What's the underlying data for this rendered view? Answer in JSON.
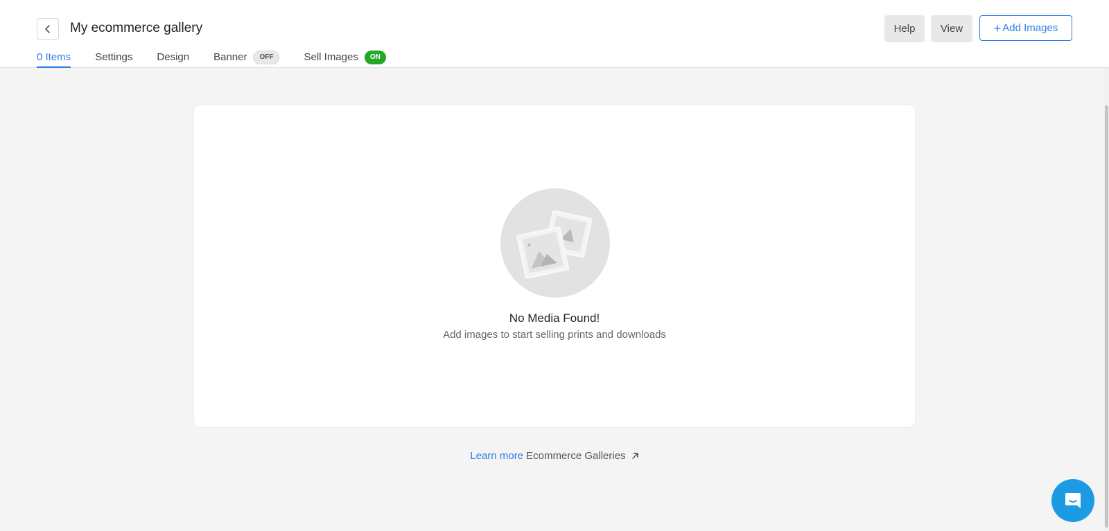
{
  "header": {
    "title": "My ecommerce gallery",
    "back_icon": "chevron-left-icon"
  },
  "tabs": [
    {
      "label": "0 Items",
      "active": true
    },
    {
      "label": "Settings",
      "active": false
    },
    {
      "label": "Design",
      "active": false
    },
    {
      "label": "Banner",
      "badge": "OFF",
      "active": false
    },
    {
      "label": "Sell Images",
      "badge": "ON",
      "active": false
    }
  ],
  "actions": {
    "help_label": "Help",
    "view_label": "View",
    "add_plus": "+",
    "add_label": "Add Images"
  },
  "empty_state": {
    "icon": "images-placeholder-icon",
    "title": "No Media Found!",
    "subtitle": "Add images to start selling prints and downloads"
  },
  "footer": {
    "link_label": "Learn more",
    "link_text": "Ecommerce Galleries",
    "arrow_icon": "external-arrow-icon"
  },
  "chat": {
    "icon": "chat-bubble-icon"
  },
  "colors": {
    "accent": "#2b7de9",
    "on_badge": "#23a725",
    "chat": "#1d9be2"
  }
}
